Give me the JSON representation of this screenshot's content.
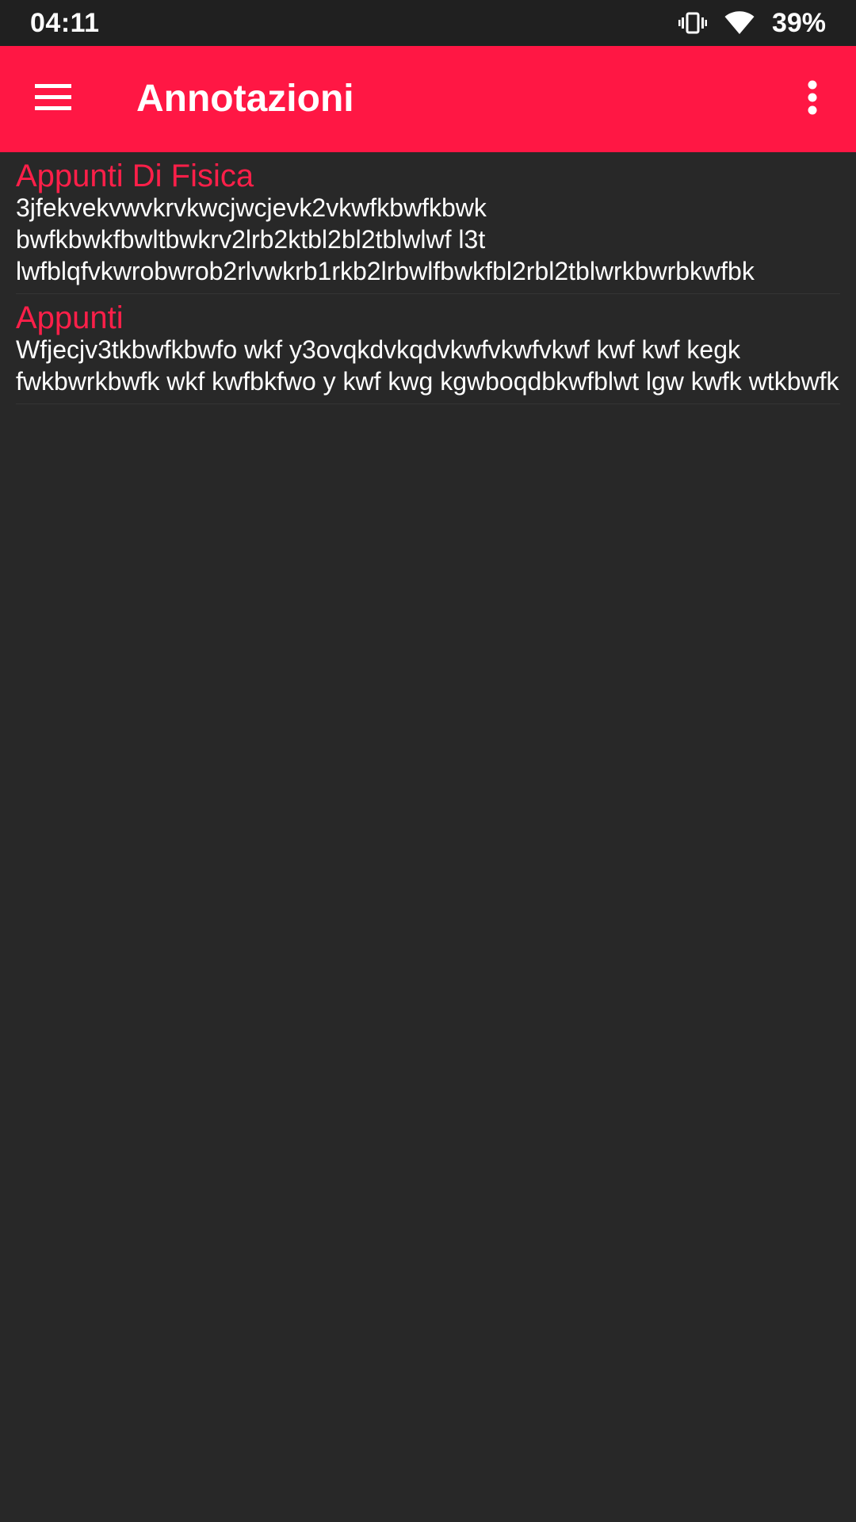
{
  "status_bar": {
    "time": "04:11",
    "battery": "39%",
    "icons": [
      "vibrate-icon",
      "wifi-icon"
    ]
  },
  "app_bar": {
    "title": "Annotazioni",
    "menu_icon": "hamburger-menu-icon",
    "overflow_icon": "more-vertical-icon",
    "color": "#ff1744"
  },
  "notes": [
    {
      "title": "Appunti Di Fisica",
      "body": "3jfekvekvwvkrvkwcjwcjevk2vkwfkbwfkbwk bwfkbwkfbwltbwkrv2lrb2ktbl2bl2tblwlwf l3t lwfblqfvkwrobwrob2rlvwkrb1rkb2lrbwlfbwkfbl2rbl2tblwrkbwrbkwfbk"
    },
    {
      "title": "Appunti",
      "body": "Wfjecjv3tkbwfkbwfo wkf y3ovqkdvkqdvkwfvkwfvkwf kwf kwf kegk fwkbwrkbwfk wkf kwfbkfwo y kwf kwg kgwboqdbkwfblwt lgw kwfk wtkbwfk"
    }
  ],
  "colors": {
    "background": "#282828",
    "status_bar": "#202020",
    "accent": "#ff1744",
    "note_title": "#ff1f49"
  }
}
